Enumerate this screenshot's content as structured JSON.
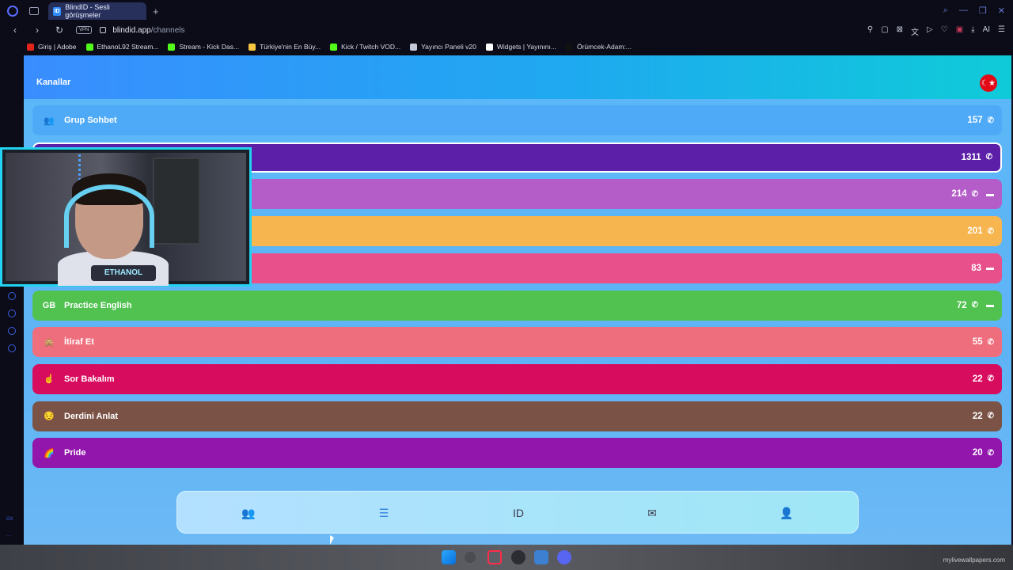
{
  "browser": {
    "tab_title": "BlindID - Sesli görüşmeler",
    "tab_favicon": "ID",
    "url_domain": "blindid.app",
    "url_path": "/channels",
    "vpn_label": "VPN",
    "ai_label": "AI"
  },
  "bookmarks": [
    {
      "label": "Giriş | Adobe",
      "color": "#e4241b"
    },
    {
      "label": "EthanoL92 Stream...",
      "color": "#53fc18"
    },
    {
      "label": "Stream - Kick Das...",
      "color": "#53fc18"
    },
    {
      "label": "Türkiye'nin En Büy...",
      "color": "#f5c542"
    },
    {
      "label": "Kick / Twitch VOD...",
      "color": "#53fc18"
    },
    {
      "label": "Yayıncı Paneli v20",
      "color": "#c4c8d8"
    },
    {
      "label": "Widgets | Yayınını...",
      "color": "#ffffff"
    },
    {
      "label": "Örümcek-Adam:...",
      "color": "#111111"
    }
  ],
  "page": {
    "title": "Kanallar",
    "flag_icon": "turkey-flag-icon",
    "flag_glyph": "☾★"
  },
  "channels": [
    {
      "name": "Grup Sohbet",
      "icon": "users-icon",
      "glyph": "👥",
      "count": "157",
      "phone": true,
      "chat": false,
      "color": "#4eaaf7",
      "active": false
    },
    {
      "name": "",
      "icon": "",
      "glyph": "",
      "count": "1311",
      "phone": true,
      "chat": false,
      "color": "#5b1fa8",
      "active": true
    },
    {
      "name": "",
      "icon": "",
      "glyph": "",
      "count": "214",
      "phone": true,
      "chat": true,
      "color": "#b45cc8",
      "active": false
    },
    {
      "name": "",
      "icon": "",
      "glyph": "",
      "count": "201",
      "phone": true,
      "chat": false,
      "color": "#f6b54f",
      "active": false
    },
    {
      "name": "",
      "icon": "",
      "glyph": "",
      "count": "83",
      "phone": false,
      "chat": true,
      "color": "#e8508c",
      "active": false
    },
    {
      "name": "Practice English",
      "icon": "gb-flag-icon",
      "glyph": "GB",
      "count": "72",
      "phone": true,
      "chat": true,
      "color": "#51c250",
      "active": false
    },
    {
      "name": "İtiraf Et",
      "icon": "mask-emoji-icon",
      "glyph": "🙊",
      "count": "55",
      "phone": true,
      "chat": false,
      "color": "#ef6e7e",
      "active": false
    },
    {
      "name": "Sor Bakalım",
      "icon": "pointing-hand-icon",
      "glyph": "☝",
      "count": "22",
      "phone": true,
      "chat": false,
      "color": "#d80c5e",
      "active": false
    },
    {
      "name": "Derdini Anlat",
      "icon": "sad-face-icon",
      "glyph": "😔",
      "count": "22",
      "phone": true,
      "chat": false,
      "color": "#7b5346",
      "active": false
    },
    {
      "name": "Pride",
      "icon": "rainbow-icon",
      "glyph": "🌈",
      "count": "20",
      "phone": true,
      "chat": false,
      "color": "#9215ac",
      "active": false
    }
  ],
  "bottom_nav": [
    {
      "name": "groups-nav-icon",
      "glyph": "👥"
    },
    {
      "name": "list-nav-icon",
      "glyph": "☰"
    },
    {
      "name": "blindid-logo-nav-icon",
      "glyph": "ID"
    },
    {
      "name": "mail-nav-icon",
      "glyph": "✉"
    },
    {
      "name": "profile-nav-icon",
      "glyph": "👤"
    }
  ],
  "webcam": {
    "overlay_text": "ETHANOL"
  },
  "taskbar": {
    "watermark": "mylivewallpapers.com"
  },
  "glyphs": {
    "phone": "✆",
    "chat": "▬"
  }
}
